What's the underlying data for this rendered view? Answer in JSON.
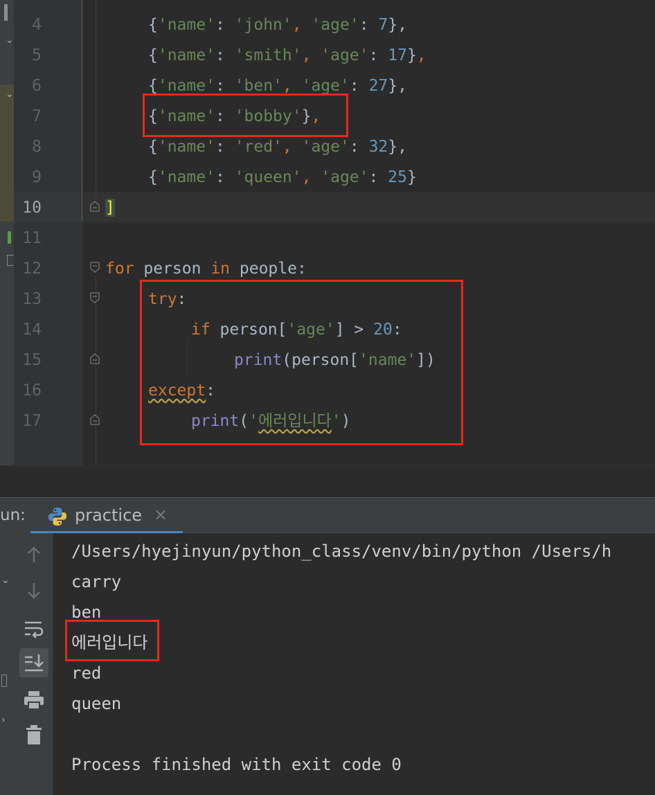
{
  "editor": {
    "lines": [
      {
        "no": "4",
        "tokens": [
          {
            "t": "{",
            "c": ""
          },
          {
            "t": "'name'",
            "c": "str"
          },
          {
            "t": ": ",
            "c": ""
          },
          {
            "t": "'john'",
            "c": "str"
          },
          {
            "t": ", ",
            "c": "kw"
          },
          {
            "t": "'age'",
            "c": "str"
          },
          {
            "t": ": ",
            "c": ""
          },
          {
            "t": "7",
            "c": "num"
          },
          {
            "t": "},",
            "c": ""
          }
        ]
      },
      {
        "no": "5",
        "tokens": [
          {
            "t": "{",
            "c": ""
          },
          {
            "t": "'name'",
            "c": "str"
          },
          {
            "t": ": ",
            "c": ""
          },
          {
            "t": "'smith'",
            "c": "str"
          },
          {
            "t": ", ",
            "c": "kw"
          },
          {
            "t": "'age'",
            "c": "str"
          },
          {
            "t": ": ",
            "c": ""
          },
          {
            "t": "17",
            "c": "num"
          },
          {
            "t": "}",
            "c": ""
          },
          {
            "t": ",",
            "c": "kw"
          }
        ]
      },
      {
        "no": "6",
        "tokens": [
          {
            "t": "{",
            "c": ""
          },
          {
            "t": "'name'",
            "c": "str"
          },
          {
            "t": ": ",
            "c": ""
          },
          {
            "t": "'ben'",
            "c": "str"
          },
          {
            "t": ", ",
            "c": "kw"
          },
          {
            "t": "'age'",
            "c": "str"
          },
          {
            "t": ": ",
            "c": ""
          },
          {
            "t": "27",
            "c": "num"
          },
          {
            "t": "},",
            "c": ""
          }
        ]
      },
      {
        "no": "7",
        "tokens": [
          {
            "t": "{",
            "c": ""
          },
          {
            "t": "'name'",
            "c": "str"
          },
          {
            "t": ": ",
            "c": ""
          },
          {
            "t": "'bobby'",
            "c": "str"
          },
          {
            "t": "}",
            "c": ""
          },
          {
            "t": ",",
            "c": "kw"
          }
        ]
      },
      {
        "no": "8",
        "tokens": [
          {
            "t": "{",
            "c": ""
          },
          {
            "t": "'name'",
            "c": "str"
          },
          {
            "t": ": ",
            "c": ""
          },
          {
            "t": "'red'",
            "c": "str"
          },
          {
            "t": ", ",
            "c": "kw"
          },
          {
            "t": "'age'",
            "c": "str"
          },
          {
            "t": ": ",
            "c": ""
          },
          {
            "t": "32",
            "c": "num"
          },
          {
            "t": "},",
            "c": ""
          }
        ]
      },
      {
        "no": "9",
        "tokens": [
          {
            "t": "{",
            "c": ""
          },
          {
            "t": "'name'",
            "c": "str"
          },
          {
            "t": ": ",
            "c": ""
          },
          {
            "t": "'queen'",
            "c": "str"
          },
          {
            "t": ", ",
            "c": "kw"
          },
          {
            "t": "'age'",
            "c": "str"
          },
          {
            "t": ": ",
            "c": ""
          },
          {
            "t": "25",
            "c": "num"
          },
          {
            "t": "}",
            "c": ""
          }
        ]
      },
      {
        "no": "10",
        "tokens": [
          {
            "t": "]",
            "c": "bracket-hl"
          }
        ]
      },
      {
        "no": "11",
        "tokens": []
      },
      {
        "no": "12",
        "tokens": [
          {
            "t": "for",
            "c": "kw"
          },
          {
            "t": " person ",
            "c": ""
          },
          {
            "t": "in",
            "c": "kw"
          },
          {
            "t": " people:",
            "c": ""
          }
        ]
      },
      {
        "no": "13",
        "tokens": [
          {
            "t": "try",
            "c": "kw"
          },
          {
            "t": ":",
            "c": ""
          }
        ]
      },
      {
        "no": "14",
        "tokens": [
          {
            "t": "if",
            "c": "kw"
          },
          {
            "t": " person[",
            "c": ""
          },
          {
            "t": "'age'",
            "c": "str"
          },
          {
            "t": "] > ",
            "c": ""
          },
          {
            "t": "20",
            "c": "num"
          },
          {
            "t": ":",
            "c": ""
          }
        ]
      },
      {
        "no": "15",
        "tokens": [
          {
            "t": "print",
            "c": "fn"
          },
          {
            "t": "(person[",
            "c": ""
          },
          {
            "t": "'name'",
            "c": "str"
          },
          {
            "t": "])",
            "c": ""
          }
        ]
      },
      {
        "no": "16",
        "tokens": [
          {
            "t": "except",
            "c": "kw squiggle"
          },
          {
            "t": ":",
            "c": ""
          }
        ]
      },
      {
        "no": "17",
        "tokens": [
          {
            "t": "print",
            "c": "fn"
          },
          {
            "t": "(",
            "c": ""
          },
          {
            "t": "'",
            "c": "str"
          },
          {
            "t": "에러입니다",
            "c": "str squiggle"
          },
          {
            "t": "'",
            "c": "str"
          },
          {
            "t": ")",
            "c": ""
          }
        ]
      }
    ],
    "current_line": "10"
  },
  "run_panel": {
    "label": "un:",
    "tab_label": "practice",
    "close_glyph": "×",
    "output": [
      "/Users/hyejinyun/python_class/venv/bin/python /Users/h",
      "carry",
      "ben",
      "에러입니다",
      "red",
      "queen",
      "",
      "Process finished with exit code 0"
    ]
  },
  "colors": {
    "highlight_box": "#e8281f",
    "keyword": "#cc7832",
    "string": "#6a8759",
    "number": "#6897bb",
    "builtin": "#8888c6"
  },
  "icons": [
    "python-icon",
    "arrow-up-icon",
    "arrow-down-icon",
    "soft-wrap-icon",
    "scroll-to-end-icon",
    "print-icon",
    "trash-icon"
  ]
}
